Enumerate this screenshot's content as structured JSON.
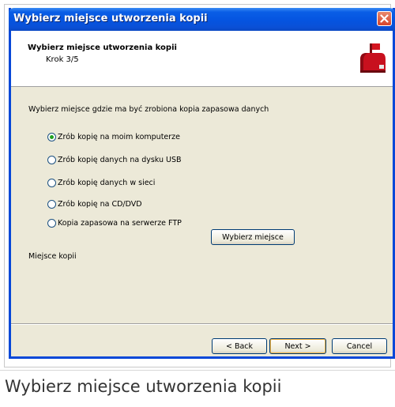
{
  "window": {
    "title": "Wybierz miejsce utworzenia kopii"
  },
  "header": {
    "title": "Wybierz miejsce utworzenia kopii",
    "step": "Krok 3/5",
    "icon": "mailbox-icon"
  },
  "content": {
    "prompt": "Wybierz miejsce gdzie ma być zrobiona kopia zapasowa danych",
    "options": [
      {
        "label": "Zrób kopię na moim komputerze",
        "checked": true
      },
      {
        "label": "Zrób kopię danych na dysku USB",
        "checked": false
      },
      {
        "label": "Zrób kopię danych w sieci",
        "checked": false
      },
      {
        "label": "Zrób kopię na CD/DVD",
        "checked": false
      },
      {
        "label": "Kopia zapasowa na serwerze FTP",
        "checked": false
      }
    ],
    "choose_button": "Wybierz miejsce",
    "destination_label": "Miejsce kopii"
  },
  "footer": {
    "back": "< Back",
    "next": "Next >",
    "cancel": "Cancel"
  },
  "caption": "Wybierz miejsce utworzenia kopii",
  "colors": {
    "titlebar": "#0554e0",
    "dialog_bg": "#ece9d8",
    "radio_dot": "#21a121",
    "close_button": "#d5432a",
    "mailbox": "#c8101e"
  }
}
